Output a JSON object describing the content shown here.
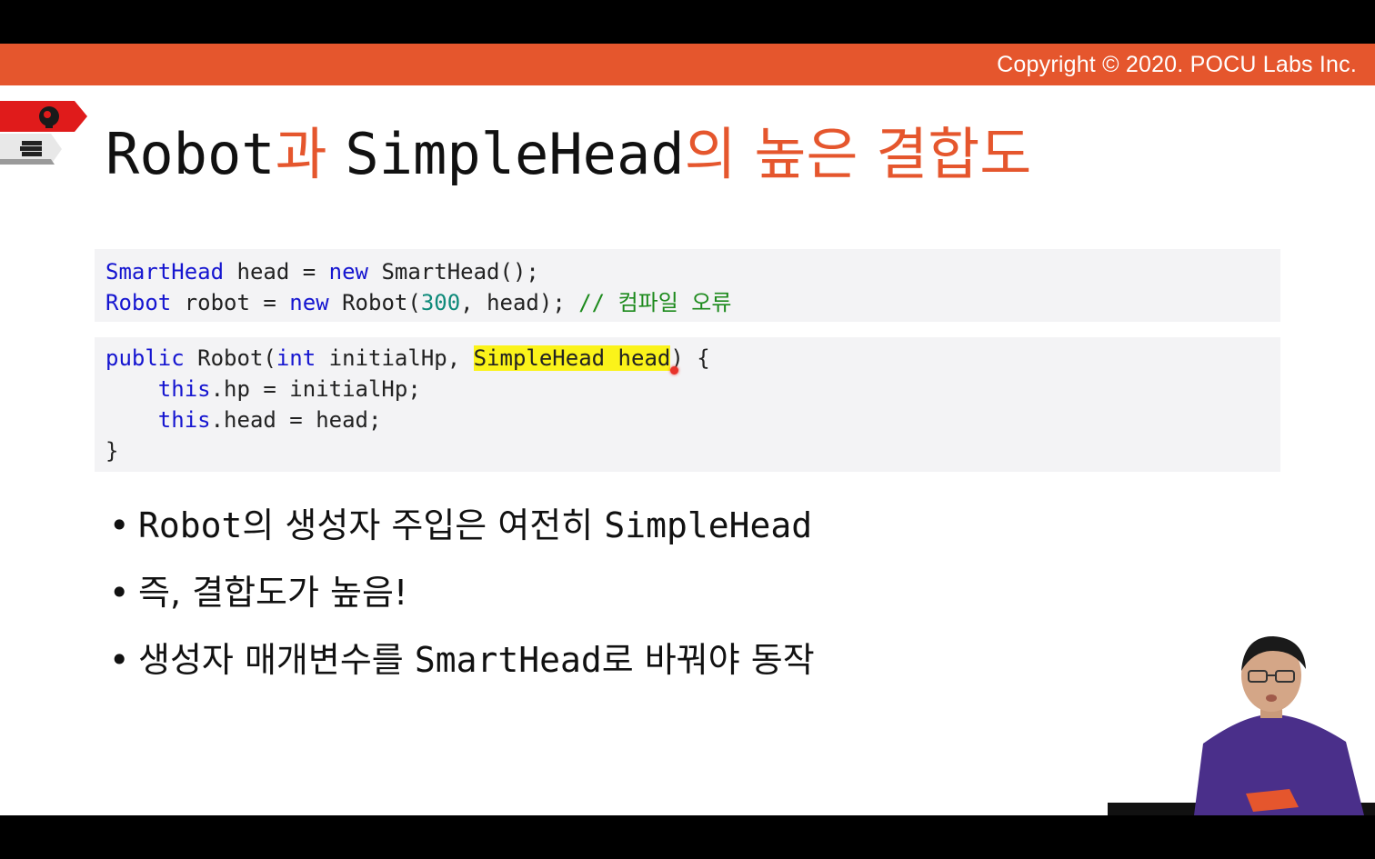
{
  "banner": {
    "copyright": "Copyright © 2020. POCU Labs Inc."
  },
  "title": {
    "part1": "Robot",
    "part2": "과 ",
    "part3": "SimpleHead",
    "part4": "의 높은 결합도"
  },
  "code_block_1": {
    "line1": {
      "type": "SmartHead",
      "a": " head = ",
      "kw": "new",
      "b": " SmartHead();"
    },
    "line2": {
      "type": "Robot",
      "a": " robot = ",
      "kw": "new",
      "b": " Robot(",
      "num": "300",
      "c": ", head); ",
      "comment": "// 컴파일 오류"
    }
  },
  "code_block_2": {
    "line1": {
      "kw1": "public",
      "a": " Robot(",
      "kw2": "int",
      "b": " initialHp, ",
      "highlight": "SimpleHead head",
      "c": ") {"
    },
    "line2": {
      "indent": "    ",
      "kw": "this",
      "a": ".hp = initialHp;"
    },
    "line3": {
      "indent": "    ",
      "kw": "this",
      "a": ".head = head;"
    },
    "line4": {
      "a": "}"
    }
  },
  "bullets": [
    {
      "dot": "•",
      "a": "Robot",
      "b": "의 생성자 주입은 여전히 ",
      "c": "SimpleHead",
      "d": ""
    },
    {
      "dot": "•",
      "a": "",
      "b": "즉, 결합도가 높음!",
      "c": "",
      "d": ""
    },
    {
      "dot": "•",
      "a": "",
      "b": "생성자 매개변수를 ",
      "c": "SmartHead",
      "d": "로 바꿔야 동작"
    }
  ],
  "icons": {
    "tag1": "brain-gear-icon",
    "tag2": "books-icon"
  },
  "colors": {
    "accent": "#e5562d",
    "keyword": "#1515d0",
    "number": "#0e8a7a",
    "comment": "#1c8a1c",
    "highlight": "#fbf31a"
  }
}
